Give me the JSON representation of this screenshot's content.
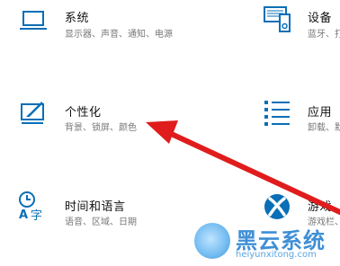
{
  "tiles": [
    {
      "title": "系统",
      "subtitle": "显示器、声音、通知、电源"
    },
    {
      "title": "设备",
      "subtitle": "蓝牙、打"
    },
    {
      "title": "个性化",
      "subtitle": "背景、锁屏、颜色"
    },
    {
      "title": "应用",
      "subtitle": "卸载、默"
    },
    {
      "title": "时间和语言",
      "subtitle": "语音、区域、日期"
    },
    {
      "title": "游戏",
      "subtitle": "游戏栏、"
    }
  ],
  "watermark": {
    "title": "黑云系统",
    "url": "heiyunxitong.com"
  },
  "colors": {
    "icon": "#0a6fb7",
    "arrow": "#e01c1c",
    "watermark": "#3f8fd6"
  }
}
